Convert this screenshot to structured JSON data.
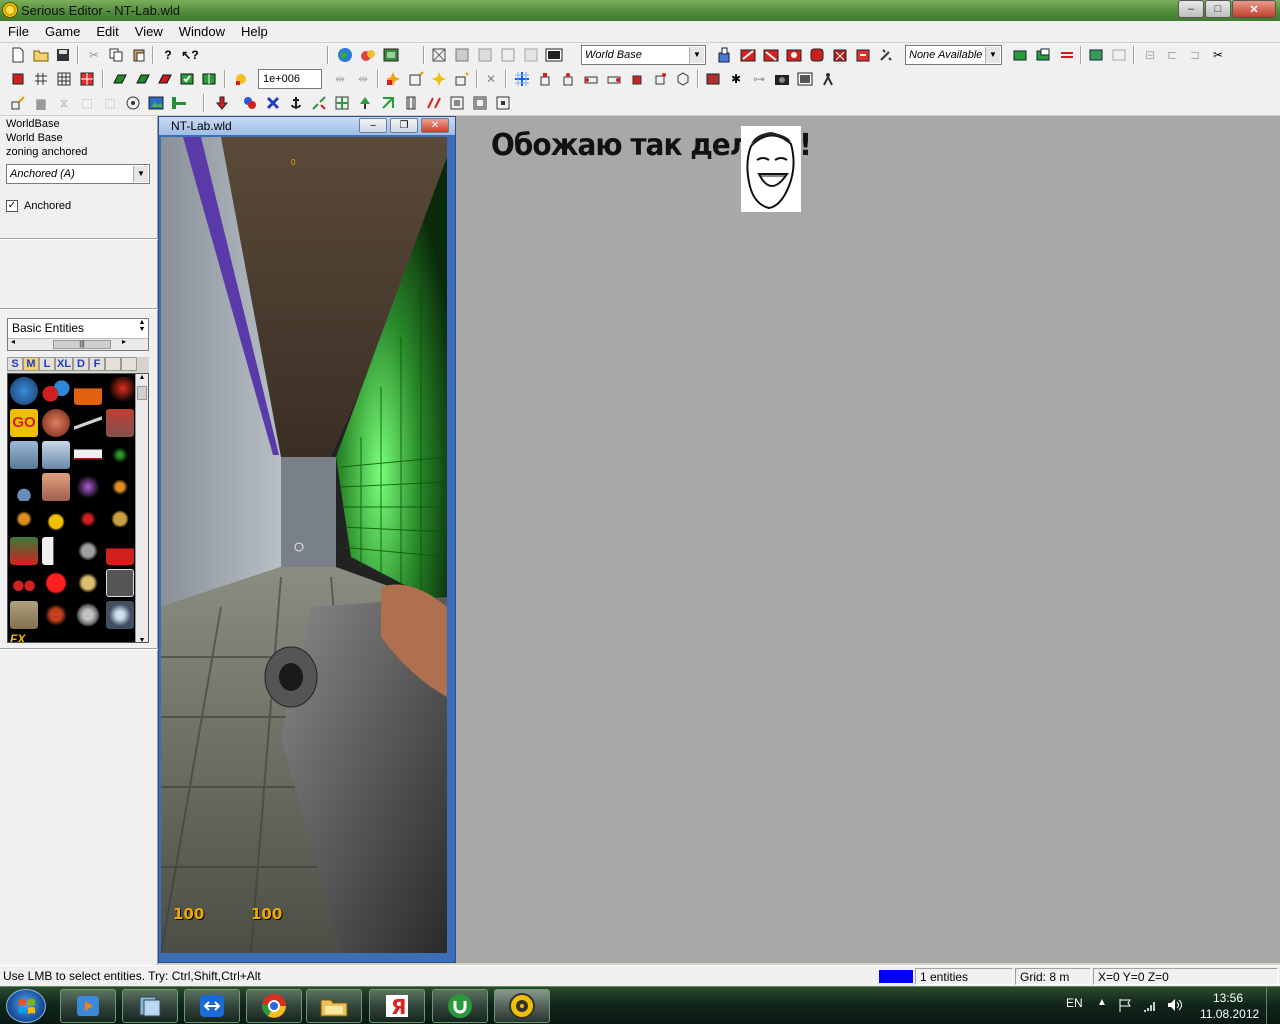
{
  "window": {
    "title": "Serious Editor - NT-Lab.wld",
    "minimize": "‒",
    "maximize": "□",
    "close": "✕"
  },
  "menu": [
    "File",
    "Game",
    "Edit",
    "View",
    "Window",
    "Help"
  ],
  "toolbar": {
    "world_base_select": "World Base",
    "none_available_select": "None Available",
    "value_field": "1e+006"
  },
  "left_panel": {
    "info_lines": [
      "WorldBase",
      "World Base",
      "zoning anchored"
    ],
    "anchor_select": "Anchored (A)",
    "anchored_checkbox_label": "Anchored",
    "anchored_checked": true,
    "entity_list_item": "Basic Entities",
    "palette_tabs": [
      "S",
      "M",
      "L",
      "XL",
      "D",
      "F"
    ]
  },
  "document": {
    "title": "NT-Lab.wld",
    "hud_health": "100",
    "hud_armor": "100",
    "hud_top_counter": "0"
  },
  "meme": {
    "text": "Обожаю так делать!"
  },
  "status": {
    "hint": "Use LMB to select entities. Try: Ctrl,Shift,Ctrl+Alt",
    "entities": "1 entities",
    "grid": "Grid: 8 m",
    "coords": "X=0 Y=0 Z=0"
  },
  "taskbar": {
    "language": "EN",
    "time": "13:56",
    "date": "11.08.2012",
    "apps": [
      "media-player",
      "explorer-folders",
      "teamviewer",
      "chrome",
      "file-manager",
      "yandex",
      "utorrent",
      "serious-editor"
    ]
  },
  "colors": {
    "title_gradient": "#4f8a3a",
    "main_bg": "#a8a8a8",
    "hud_color": "#f0a800",
    "status_blue": "#0000ff"
  }
}
